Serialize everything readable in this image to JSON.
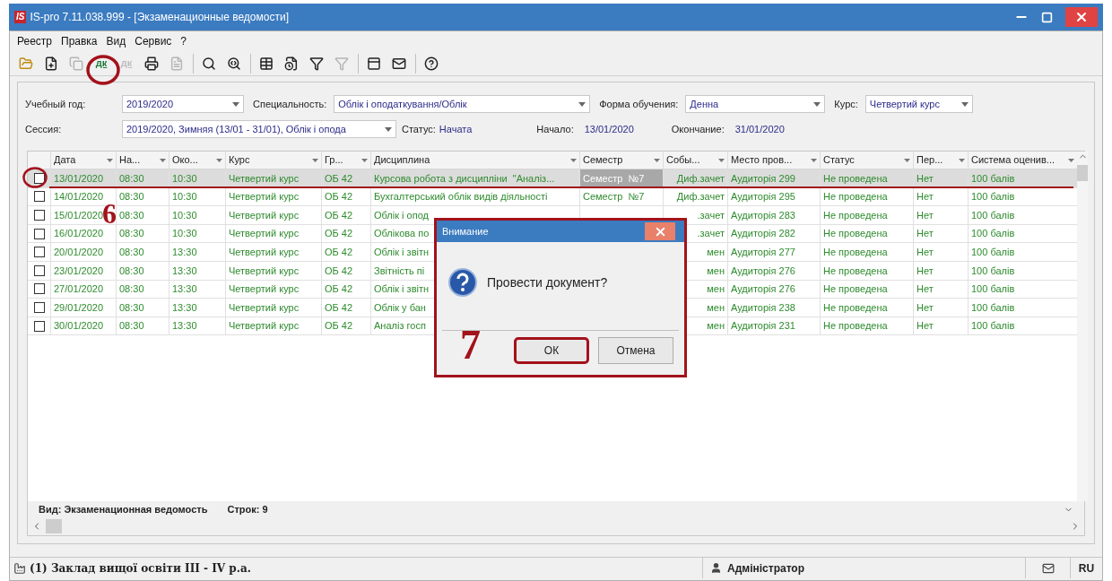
{
  "window": {
    "title": "IS-pro 7.11.038.999 - [Экзаменационные ведомости]",
    "logo": "IS"
  },
  "menu": [
    "Реестр",
    "Правка",
    "Вид",
    "Сервис",
    "?"
  ],
  "toolbar": [
    {
      "disabled": false
    },
    {
      "disabled": false
    },
    {
      "disabled": true
    },
    {
      "disabled": false,
      "label": "дк"
    },
    {
      "disabled": true,
      "label": "дк"
    },
    {
      "disabled": false
    },
    {
      "disabled": true
    },
    {
      "disabled": false,
      "separator_before": true
    },
    {
      "disabled": false
    },
    {
      "disabled": false,
      "separator_before": true
    },
    {
      "disabled": false
    },
    {
      "disabled": false
    },
    {
      "disabled": true
    },
    {
      "disabled": false,
      "separator_before": true
    },
    {
      "disabled": false
    },
    {
      "disabled": false,
      "separator_before": true
    }
  ],
  "filters": {
    "year": {
      "label": "Учебный год:",
      "value": "2019/2020"
    },
    "specialty": {
      "label": "Специальность:",
      "value": "Облік і оподаткування/Облік"
    },
    "form": {
      "label": "Форма обучения:",
      "value": "Денна"
    },
    "course": {
      "label": "Курс:",
      "value": "Четвертий курс"
    },
    "session": {
      "label": "Сессия:",
      "value": "2019/2020, Зимняя (13/01 - 31/01), Облік і опода"
    },
    "status": {
      "label": "Статус:",
      "value": "Начата"
    },
    "start": {
      "label": "Начало:",
      "value": "13/01/2020"
    },
    "end": {
      "label": "Окончание:",
      "value": "31/01/2020"
    }
  },
  "table": {
    "columns": [
      "Дата",
      "На...",
      "Око...",
      "Курс",
      "Гр...",
      "Дисциплина",
      "Семестр",
      "Собы...",
      "Место пров...",
      "Статус",
      "Пер...",
      "Система оценив..."
    ],
    "rows": [
      {
        "selected": true,
        "checked": false,
        "date": "13/01/2020",
        "start": "08:30",
        "end": "10:30",
        "course": "Четвертий курс",
        "group": "ОБ 42",
        "discipline": "Курсова робота з дисципліни  \"Аналіз...",
        "semester": "Семестр  №7",
        "event": "Диф.зачет",
        "place": "Аудиторія 299",
        "status": "Не проведена",
        "retake": "Нет",
        "grading": "100 балів"
      },
      {
        "selected": false,
        "checked": false,
        "date": "14/01/2020",
        "start": "08:30",
        "end": "10:30",
        "course": "Четвертий курс",
        "group": "ОБ 42",
        "discipline": "Бухгалтерський облік видів діяльності",
        "semester": "Семестр  №7",
        "event": "Диф.зачет",
        "place": "Аудиторія 295",
        "status": "Не проведена",
        "retake": "Нет",
        "grading": "100 балів"
      },
      {
        "selected": false,
        "checked": false,
        "date": "15/01/2020",
        "start": "08:30",
        "end": "10:30",
        "course": "Четвертий курс",
        "group": "ОБ 42",
        "discipline": "Облік і опод",
        "event": ".зачет",
        "place": "Аудиторія 283",
        "status": "Не проведена",
        "retake": "Нет",
        "grading": "100 балів"
      },
      {
        "selected": false,
        "checked": false,
        "date": "16/01/2020",
        "start": "08:30",
        "end": "10:30",
        "course": "Четвертий курс",
        "group": "ОБ 42",
        "discipline": "Облікова по",
        "event": ".зачет",
        "place": "Аудиторія 282",
        "status": "Не проведена",
        "retake": "Нет",
        "grading": "100 балів"
      },
      {
        "selected": false,
        "checked": false,
        "date": "20/01/2020",
        "start": "08:30",
        "end": "13:30",
        "course": "Четвертий курс",
        "group": "ОБ 42",
        "discipline": "Облік і звітн",
        "event": "мен",
        "place": "Аудиторія 277",
        "status": "Не проведена",
        "retake": "Нет",
        "grading": "100 балів"
      },
      {
        "selected": false,
        "checked": false,
        "date": "23/01/2020",
        "start": "08:30",
        "end": "13:30",
        "course": "Четвертий курс",
        "group": "ОБ 42",
        "discipline": "Звітність пі",
        "event": "мен",
        "place": "Аудиторія 276",
        "status": "Не проведена",
        "retake": "Нет",
        "grading": "100 балів"
      },
      {
        "selected": false,
        "checked": false,
        "date": "27/01/2020",
        "start": "08:30",
        "end": "13:30",
        "course": "Четвертий курс",
        "group": "ОБ 42",
        "discipline": "Облік і звітн",
        "event": "мен",
        "place": "Аудиторія 276",
        "status": "Не проведена",
        "retake": "Нет",
        "grading": "100 балів"
      },
      {
        "selected": false,
        "checked": false,
        "date": "29/01/2020",
        "start": "08:30",
        "end": "13:30",
        "course": "Четвертий курс",
        "group": "ОБ 42",
        "discipline": "Облік у бан",
        "event": "мен",
        "place": "Аудиторія 238",
        "status": "Не проведена",
        "retake": "Нет",
        "grading": "100 балів"
      },
      {
        "selected": false,
        "checked": false,
        "date": "30/01/2020",
        "start": "08:30",
        "end": "13:30",
        "course": "Четвертий курс",
        "group": "ОБ 42",
        "discipline": "Аналіз госп",
        "event": "мен",
        "place": "Аудиторія 231",
        "status": "Не проведена",
        "retake": "Нет",
        "grading": "100 балів"
      }
    ]
  },
  "footer": {
    "view": "Вид: Экзаменационная ведомость",
    "rows": "Строк: 9"
  },
  "status_bar": {
    "organization": "(1) Заклад вищої освіти III - IV р.а.",
    "user": "Адміністратор",
    "language": "RU"
  },
  "dialog": {
    "title": "Внимание",
    "message": "Провести документ?",
    "buttons": [
      {
        "label": "ОК",
        "default": true
      },
      {
        "label": "Отмена",
        "default": false
      }
    ]
  },
  "annotations": [
    {
      "label": "6"
    },
    {
      "label": "7"
    }
  ]
}
